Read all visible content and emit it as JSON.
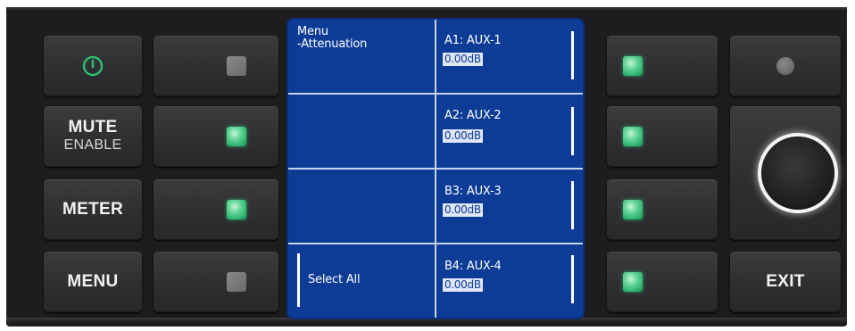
{
  "left_buttons": {
    "power_icon": "power-icon",
    "mute_label": "MUTE",
    "mute_sub": "ENABLE",
    "meter_label": "METER",
    "menu_label": "MENU"
  },
  "indicators": {
    "left": [
      "off",
      "on",
      "on",
      "off"
    ],
    "right": [
      "on",
      "on",
      "on",
      "on"
    ],
    "on_color": "#4fd08a",
    "off_color": "#7a7a7c"
  },
  "lcd": {
    "menu_title": "Menu",
    "menu_subtitle": "-Attenuation",
    "select_all": "Select All",
    "channels": [
      {
        "name": "A1: AUX-1",
        "value": "0.00dB"
      },
      {
        "name": "A2: AUX-2",
        "value": "0.00dB"
      },
      {
        "name": "B3: AUX-3",
        "value": "0.00dB"
      },
      {
        "name": "B4: AUX-4",
        "value": "0.00dB"
      }
    ],
    "background_color": "#0d3c96"
  },
  "right_buttons": {
    "exit_label": "EXIT"
  }
}
